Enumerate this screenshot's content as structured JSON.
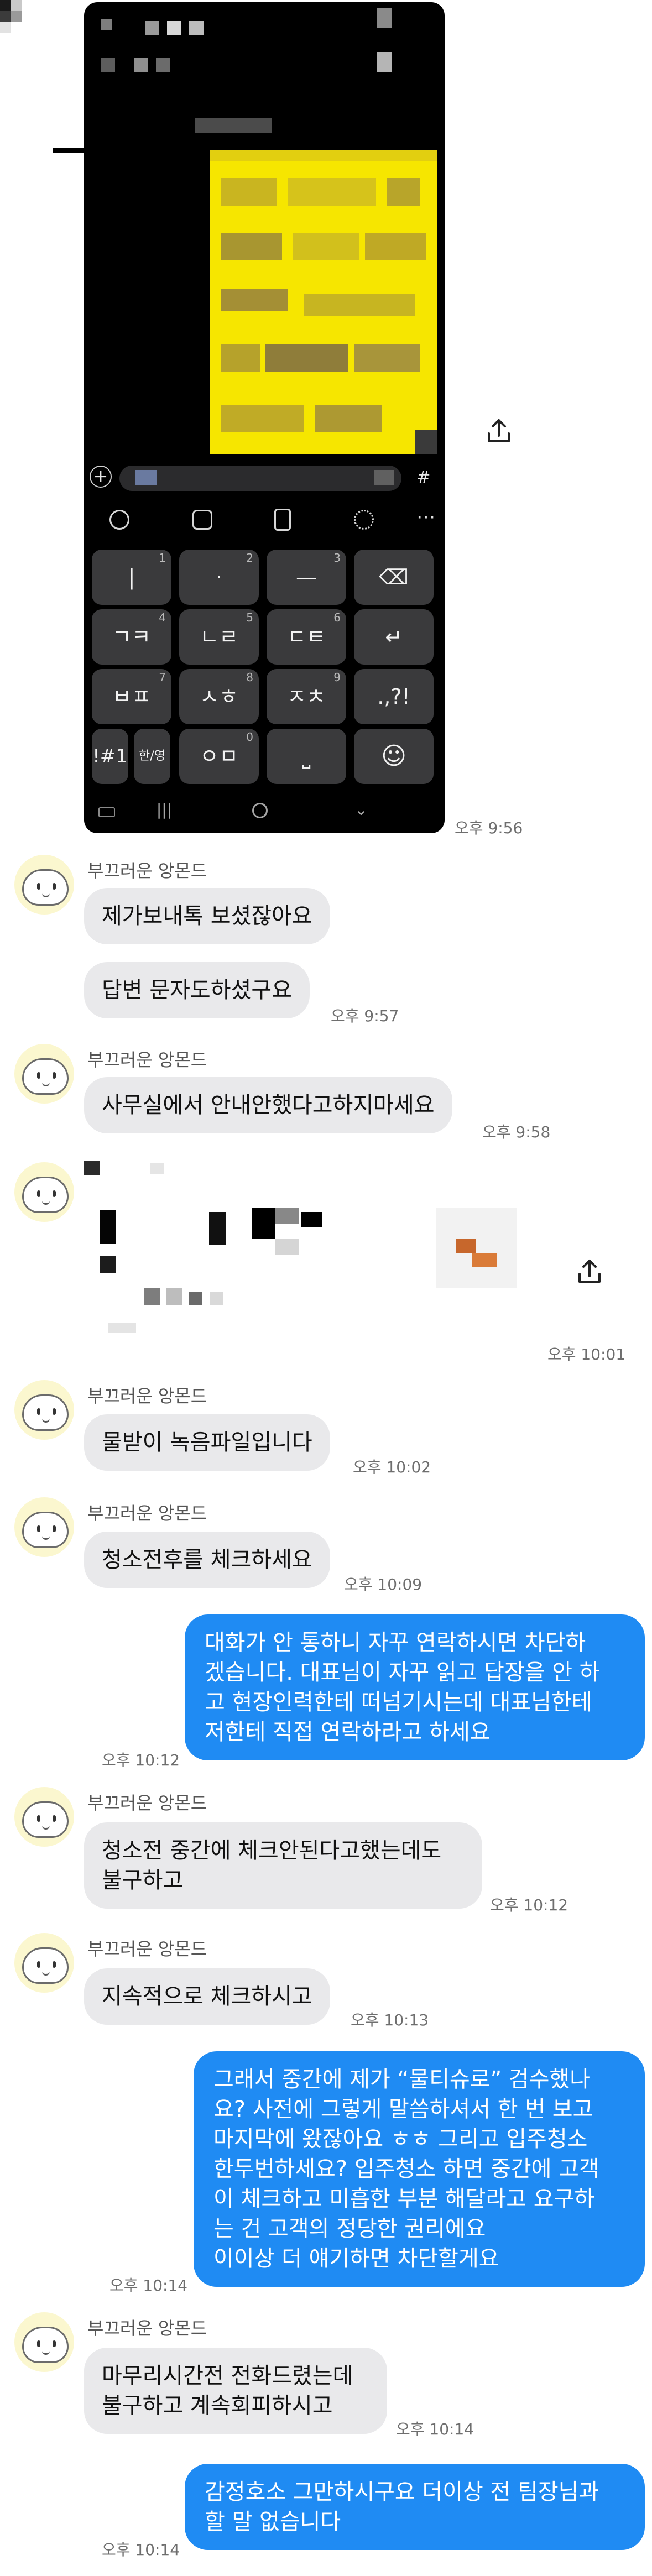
{
  "contact": {
    "name": "부끄러운 앙몬드"
  },
  "screenshot_keyboard": {
    "rows": [
      [
        {
          "label": "|",
          "num": "1"
        },
        {
          "label": "·",
          "num": "2"
        },
        {
          "label": "—",
          "num": "3"
        },
        {
          "label": "⌫",
          "num": ""
        }
      ],
      [
        {
          "label": "ㄱㅋ",
          "num": "4"
        },
        {
          "label": "ㄴㄹ",
          "num": "5"
        },
        {
          "label": "ㄷㅌ",
          "num": "6"
        },
        {
          "label": "↵",
          "num": ""
        }
      ],
      [
        {
          "label": "ㅂㅍ",
          "num": "7"
        },
        {
          "label": "ㅅㅎ",
          "num": "8"
        },
        {
          "label": "ㅈㅊ",
          "num": "9"
        },
        {
          "label": ".,?!",
          "num": ""
        }
      ],
      [
        {
          "label": "!#1",
          "num": ""
        },
        {
          "label": "한/영",
          "num": ""
        },
        {
          "label": "ㅇㅁ",
          "num": "0"
        },
        {
          "label": "⎵",
          "num": ""
        },
        {
          "label": "☺",
          "num": ""
        }
      ]
    ]
  },
  "messages": [
    {
      "dir": "in",
      "text": "제가보내톡 보셨잖아요",
      "time": ""
    },
    {
      "dir": "in",
      "text": "답변 문자도하셨구요",
      "time": "오후 9:57"
    },
    {
      "dir": "in",
      "text": "사무실에서 안내안했다고하지마세요",
      "time": "오후 9:58"
    },
    {
      "dir": "in",
      "text": "물받이 녹음파일입니다",
      "time": "오후 10:02"
    },
    {
      "dir": "in",
      "text": "청소전후를 체크하세요",
      "time": "오후 10:09"
    },
    {
      "dir": "out",
      "lines": [
        "대화가 안 통하니 자꾸 연락하시면 차단하",
        "겠습니다. 대표님이 자꾸 읽고 답장을 안 하",
        "고 현장인력한테 떠넘기시는데 대표님한테",
        "저한테 직접 연락하라고 하세요"
      ],
      "time": "오후 10:12"
    },
    {
      "dir": "in",
      "lines": [
        "청소전 중간에 체크안된다고했는데도",
        "불구하고"
      ],
      "time": "오후 10:12"
    },
    {
      "dir": "in",
      "text": "지속적으로 체크하시고",
      "time": "오후 10:13"
    },
    {
      "dir": "out",
      "lines": [
        "그래서 중간에 제가 “물티슈로” 검수했나",
        "요? 사전에 그렇게 말씀하셔서 한 번 보고",
        "마지막에 왔잖아요 ㅎㅎ 그리고 입주청소",
        "한두번하세요? 입주청소 하면 중간에 고객",
        "이 체크하고 미흡한 부분 해달라고 요구하",
        "는 건 고객의 정당한 권리에요",
        "이이상 더 얘기하면 차단할게요"
      ],
      "time": "오후 10:14"
    },
    {
      "dir": "in",
      "lines": [
        "마무리시간전 전화드렸는데",
        "불구하고 계속회피하시고"
      ],
      "time": "오후 10:14"
    },
    {
      "dir": "out",
      "lines": [
        "감정호소 그만하시구요 더이상 전 팀장님과",
        "할 말 없습니다"
      ],
      "time": "오후 10:14"
    }
  ],
  "image_times": {
    "screenshot": "오후 9:56",
    "attachment": "오후 10:01"
  },
  "colors": {
    "outgoing_bubble": "#1f8bf3",
    "incoming_bubble": "#e9e9eb",
    "highlight": "#f6e600"
  }
}
